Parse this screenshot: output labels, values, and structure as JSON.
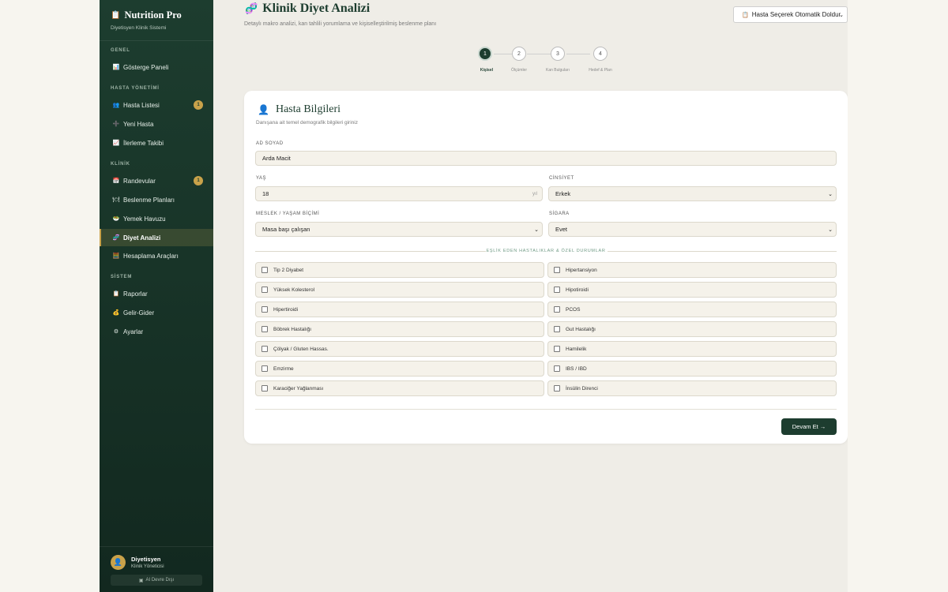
{
  "brand": {
    "title": "Nutrition Pro",
    "subtitle": "Diyetisyen Klinik Sistemi"
  },
  "sidebar": {
    "sections": [
      "GENEL",
      "HASTA YÖNETİMİ",
      "KLİNİK",
      "SİSTEM"
    ],
    "items": [
      {
        "label": "Gösterge Paneli",
        "icon": "📊"
      },
      {
        "label": "Hasta Listesi",
        "icon": "👥",
        "badge": "1"
      },
      {
        "label": "Yeni Hasta",
        "icon": "➕"
      },
      {
        "label": "İlerleme Takibi",
        "icon": "📈"
      },
      {
        "label": "Randevular",
        "icon": "📅",
        "badge": "1"
      },
      {
        "label": "Beslenme Planları",
        "icon": "🍽"
      },
      {
        "label": "Yemek Havuzu",
        "icon": "🥗"
      },
      {
        "label": "Diyet Analizi",
        "icon": "🧬"
      },
      {
        "label": "Hesaplama Araçları",
        "icon": "🧮"
      },
      {
        "label": "Raporlar",
        "icon": "📋"
      },
      {
        "label": "Gelir-Gider",
        "icon": "💰"
      },
      {
        "label": "Ayarlar",
        "icon": "⚙"
      }
    ],
    "active_index": 7
  },
  "user": {
    "name": "Diyetisyen",
    "role": "Klinik Yöneticisi",
    "ai_button": "AI Devre Dışı"
  },
  "header": {
    "title": "Klinik Diyet Analizi",
    "subtitle": "Detaylı makro analizi, kan tahlili yorumlama ve kişiselleştirilmiş beslenme planı",
    "auto_fill": "Hasta Seçerek Otomatik Doldur"
  },
  "stepper": {
    "steps": [
      {
        "num": "1",
        "label": "Kişisel"
      },
      {
        "num": "2",
        "label": "Ölçümler"
      },
      {
        "num": "3",
        "label": "Kan Bulguları"
      },
      {
        "num": "4",
        "label": "Hedef & Plan"
      }
    ],
    "active": 0
  },
  "form": {
    "title": "Hasta Bilgileri",
    "subtitle": "Danışana ait temel demografik bilgileri giriniz",
    "name_label": "AD SOYAD",
    "name_value": "Arda Macit",
    "age_label": "YAŞ",
    "age_value": "18",
    "age_suffix": "yıl",
    "gender_label": "CİNSİYET",
    "gender_value": "Erkek",
    "job_label": "MESLEK / YAŞAM BİÇİMİ",
    "job_value": "Masa başı çalışan",
    "smoke_label": "SİGARA",
    "smoke_value": "Evet",
    "conditions_title": "EŞLİK EDEN HASTALIKLAR & ÖZEL DURUMLAR",
    "conditions": [
      "Tip 2 Diyabet",
      "Hipertansiyon",
      "Yüksek Kolesterol",
      "Hipotiroidi",
      "Hipertiroidi",
      "PCOS",
      "Böbrek Hastalığı",
      "Gut Hastalığı",
      "Çölyak / Gluten Hassas.",
      "Hamilelik",
      "Emzirme",
      "IBS / IBD",
      "Karaciğer Yağlanması",
      "İnsülin Direnci"
    ],
    "next_button": "Devam Et →"
  }
}
